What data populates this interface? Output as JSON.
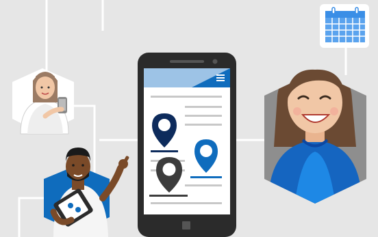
{
  "colors": {
    "background": "#e6e6e6",
    "connector_lines": "#ffffff",
    "phone_body": "#2b2b2b",
    "phone_header": "#9dc3e6",
    "accent_blue": "#0f6cbd",
    "dark_navy": "#0d2b5c",
    "pin_gray": "#3c3c3c",
    "content_lines": "#c8c8c8",
    "calendar_blue": "#3a8ee6"
  },
  "icons": [
    "hamburger-menu-icon",
    "map-pin-icon",
    "calendar-icon",
    "phone-icon",
    "tablet-icon"
  ],
  "people": [
    "woman-with-phone-avatar",
    "man-with-tablet-avatar",
    "smiling-woman-avatar"
  ]
}
